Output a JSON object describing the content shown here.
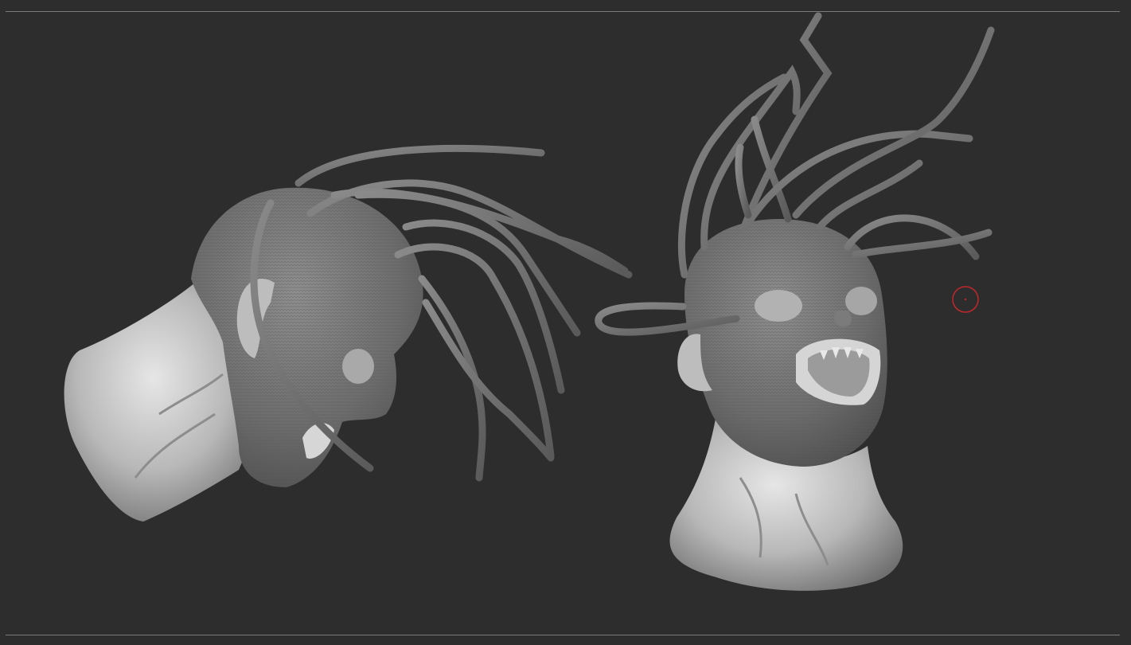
{
  "viewport": {
    "background": "#2d2d2d",
    "frame_line_color": "#7a7a7a",
    "brush_cursor_color": "#c0282b",
    "material": "matcap-gray"
  },
  "models": [
    {
      "name": "head-left",
      "view": "side-profile",
      "icon": "sculpt-head"
    },
    {
      "name": "head-right",
      "view": "front-tilted-open-mouth",
      "icon": "sculpt-head"
    }
  ]
}
